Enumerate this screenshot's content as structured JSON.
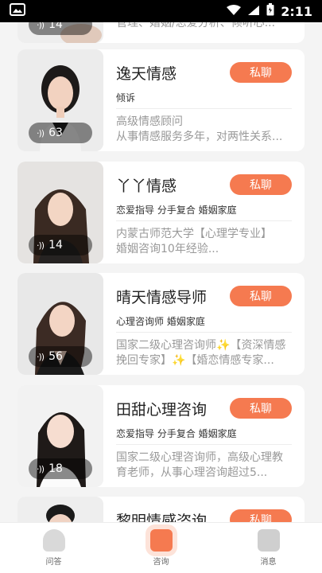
{
  "status_bar": {
    "time": "2:11"
  },
  "partial_top_card": {
    "listen_count": "14",
    "description": "管理、婚姻/恋爱分析、倾听心..."
  },
  "cards": [
    {
      "name": "逸天情感",
      "chat_label": "私聊",
      "tags": "倾诉",
      "description": "高级情感顾问\n从事情感服务多年，对两性关系...",
      "listen_count": "63"
    },
    {
      "name": "丫丫情感",
      "chat_label": "私聊",
      "tags": "恋爱指导 分手复合 婚姻家庭",
      "description": "内蒙古师范大学【心理学专业】\n婚姻咨询10年经验...",
      "listen_count": "14"
    },
    {
      "name": "晴天情感导师",
      "chat_label": "私聊",
      "tags": "心理咨询师 婚姻家庭",
      "description": "国家二级心理咨询师✨【资深情感挽回专家】✨【婚恋情感专家...",
      "listen_count": "56"
    },
    {
      "name": "田甜心理咨询",
      "chat_label": "私聊",
      "tags": "恋爱指导 分手复合 婚姻家庭",
      "description": "国家二级心理咨询师，高级心理教育老师，从事心理咨询超过5...",
      "listen_count": "18"
    },
    {
      "name": "黎明情感咨询",
      "chat_label": "私聊"
    }
  ],
  "tab_bar": {
    "tabs": [
      {
        "label": "问答"
      },
      {
        "label": "咨询"
      },
      {
        "label": "消息"
      }
    ]
  },
  "colors": {
    "accent": "#f57a50",
    "background": "#f4f4f4"
  }
}
